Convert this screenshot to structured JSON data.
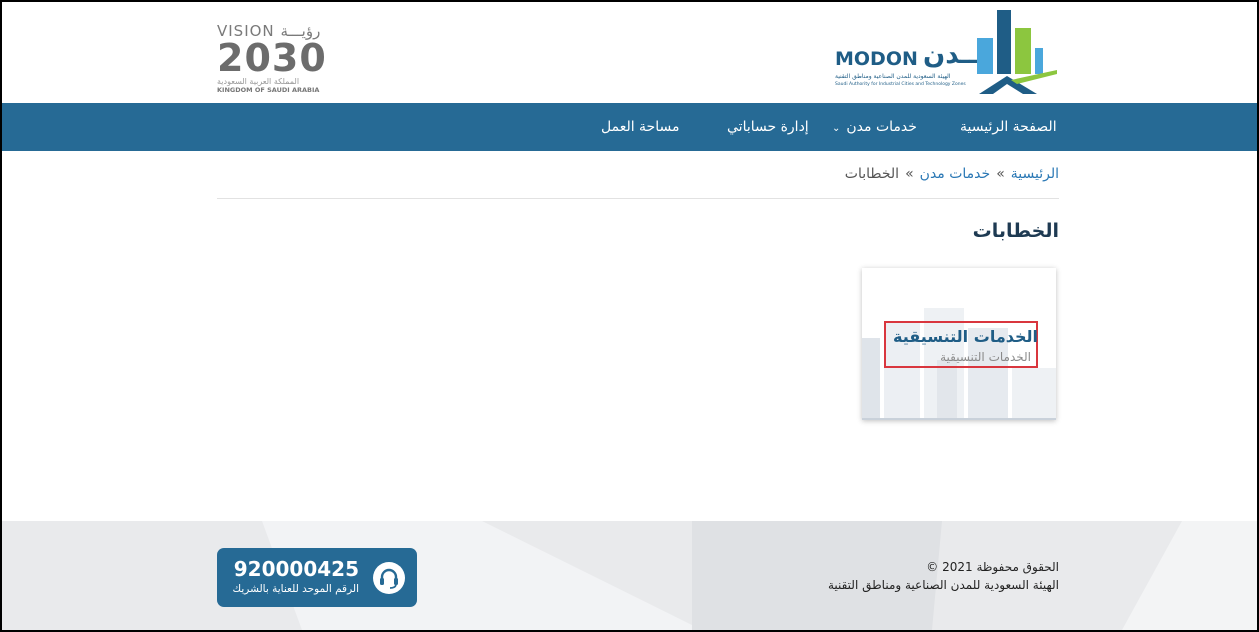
{
  "header": {
    "vision_logo": {
      "vision_text": "VISION رؤيـــة",
      "year": "2030",
      "arabic_kingdom": "المملكة العربية السعودية",
      "english_kingdom": "KINGDOM OF SAUDI ARABIA"
    },
    "modon_logo": {
      "name_en": "MODON",
      "name_ar": "مــدن",
      "subtitle_ar": "الهيئة السعودية للمدن الصناعية ومناطق التقنية",
      "subtitle_en": "Saudi Authority for Industrial Cities and Technology Zones"
    }
  },
  "nav": {
    "home": "الصفحة الرئيسية",
    "modon_services": "خدمات مدن",
    "manage_accounts": "إدارة حساباتي",
    "workspace": "مساحة العمل"
  },
  "breadcrumb": {
    "home": "الرئيسية",
    "separator": "»",
    "services": "خدمات مدن",
    "current": "الخطابات"
  },
  "page": {
    "title": "الخطابات"
  },
  "card": {
    "title": "الخدمات التنسيقية",
    "subtitle": "الخدمات التنسيقية"
  },
  "footer": {
    "copyright": "الحقوق محفوظة 2021 ©",
    "authority": "الهيئة السعودية للمدن الصناعية ومناطق التقنية",
    "hotline_number": "920000425",
    "hotline_label": "الرقم الموحد للعناية بالشريك",
    "hotline_icon": "headset-icon"
  },
  "colors": {
    "nav_bg": "#266a95",
    "brand_blue": "#1f5d86",
    "link": "#2a78b5",
    "highlight_border": "#d9363e",
    "footer_bg": "#e9eaec"
  }
}
